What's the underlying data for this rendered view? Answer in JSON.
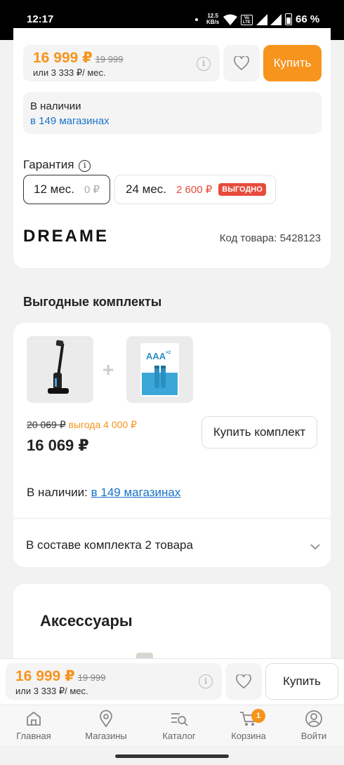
{
  "status_bar": {
    "time": "12:17",
    "speed_value": "12.5",
    "speed_unit": "KB/s",
    "network_badge_top": "Vo",
    "network_badge_bottom": "LTE",
    "battery": "66 %"
  },
  "product_price": {
    "price": "16 999 ₽",
    "old_price": "19 999",
    "installment": "или 3 333 ₽/ мес.",
    "buy_label": "Купить"
  },
  "availability": {
    "status": "В наличии",
    "stores_link": "в 149 магазинах"
  },
  "warranty": {
    "title": "Гарантия",
    "options": [
      {
        "term": "12 мес.",
        "price": "0 ₽",
        "badge": "",
        "selected": true
      },
      {
        "term": "24 мес.",
        "price": "2 600 ₽",
        "badge": "ВЫГОДНО",
        "selected": false
      }
    ]
  },
  "brand": {
    "logo_text": "DREAME",
    "sku_label": "Код товара: 5428123"
  },
  "bundles": {
    "section_title": "Выгодные комплекты",
    "battery_pack_label": "AAA",
    "battery_pack_count": "×2",
    "old_price": "20 069 ₽",
    "savings": "выгода 4 000 ₽",
    "price": "16 069 ₽",
    "buy_label": "Купить комплект",
    "availability_prefix": "В наличии:",
    "availability_link": "в 149 магазинах",
    "contents_label": "В составе комплекта 2 товара"
  },
  "accessories": {
    "section_title": "Аксессуары"
  },
  "sticky_bar": {
    "price": "16 999 ₽",
    "old_price": "19 999",
    "installment": "или 3 333 ₽/ мес.",
    "buy_label": "Купить"
  },
  "bottom_nav": {
    "items": [
      {
        "label": "Главная",
        "icon": "home-icon"
      },
      {
        "label": "Магазины",
        "icon": "map-pin-icon"
      },
      {
        "label": "Каталог",
        "icon": "catalog-search-icon"
      },
      {
        "label": "Корзина",
        "icon": "cart-icon",
        "badge": "1"
      },
      {
        "label": "Войти",
        "icon": "user-icon"
      }
    ]
  },
  "colors": {
    "accent": "#f7941d",
    "link": "#1a73c8",
    "sale_badge": "#e84b3c",
    "background": "#f2f2f2"
  }
}
